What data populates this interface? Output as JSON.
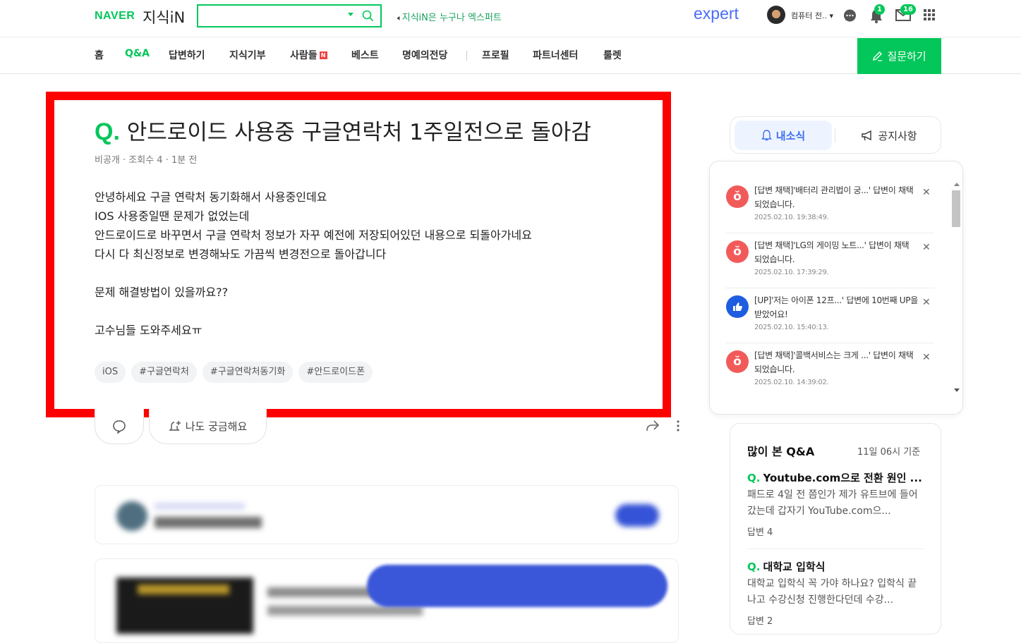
{
  "header": {
    "logo_naver": "NAVER",
    "logo_service": "지식iN",
    "search_placeholder": "",
    "promo_text": "지식iN은 누구나 엑스퍼트",
    "expert_logo": "expert",
    "username": "컴퓨터 전..",
    "notification_count": "1",
    "mail_count": "16",
    "icons": [
      "search-icon",
      "speaker-icon",
      "chat-icon",
      "bell-icon",
      "mail-icon",
      "apps-grid-icon"
    ]
  },
  "nav": {
    "items": [
      "홈",
      "Q&A",
      "답변하기",
      "지식기부",
      "사람들",
      "베스트",
      "명예의전당",
      "프로필",
      "파트너센터",
      "룰렛"
    ],
    "active": "Q&A",
    "new_badge": "N",
    "ask_button": "질문하기"
  },
  "question": {
    "q_mark": "Q.",
    "title": "안드로이드 사용중 구글연락처 1주일전으로 돌아감",
    "meta": "비공개 · 조회수 4 · 1분 전",
    "body": [
      "안녕하세요 구글 연락처 동기화해서 사용중인데요",
      "IOS 사용중일땐 문제가 없었는데",
      "안드로이드로 바꾸면서 구글 연락처 정보가 자꾸 예전에 저장되어있던 내용으로 되돌아가네요",
      "다시 다 최신정보로 변경해놔도 가끔씩 변경전으로 돌아갑니다",
      "",
      "문제 해결방법이 있을까요??",
      "",
      "고수님들 도와주세요ㅠ"
    ],
    "tags": [
      "iOS",
      "#구글연락처",
      "#구글연락처동기화",
      "#안드로이드폰"
    ],
    "curious_button": "나도 궁금해요"
  },
  "side_tabs": {
    "my_news": "내소식",
    "notice": "공지사항"
  },
  "notifications": [
    {
      "type": "adopt",
      "text": "[답변 채택]'배터리 관리법이 궁...' 답변이 채택되었습니다.",
      "time": "2025.02.10. 19:38:49."
    },
    {
      "type": "adopt",
      "text": "[답변 채택]'LG의 게이밍 노트...' 답변이 채택 되었습니다.",
      "time": "2025.02.10. 17:39:29."
    },
    {
      "type": "up",
      "text": "[UP]'저는 아이폰 12프...' 답변에 10번째 UP을 받았어요!",
      "time": "2025.02.10. 15:40:13."
    },
    {
      "type": "adopt",
      "text": "[답변 채택]'콜백서비스는 크게 ...' 답변이 채택되었습니다.",
      "time": "2025.02.10. 14:39:02."
    }
  ],
  "colors": {
    "brand": "#03c75a",
    "adopt": "#f25a5a",
    "up": "#1f5de0",
    "highlight": "#ff0000"
  },
  "popular": {
    "title": "많이 본 Q&A",
    "basis": "11일 06시 기준",
    "items": [
      {
        "q": "Q.",
        "title": "Youtube.com으로 전환 원인 ...",
        "desc": "패드로 4일 전 쯤인가 제가 유트브에 들어갔는데 갑자기 YouTube.com으...",
        "answers": "답변 4"
      },
      {
        "q": "Q.",
        "title": "대학교 입학식",
        "desc": "대학교 입학식 꼭 가야 하나요? 입학식 끝나고 수강신청 진행한다던데 수강...",
        "answers": "답변 2"
      }
    ]
  }
}
